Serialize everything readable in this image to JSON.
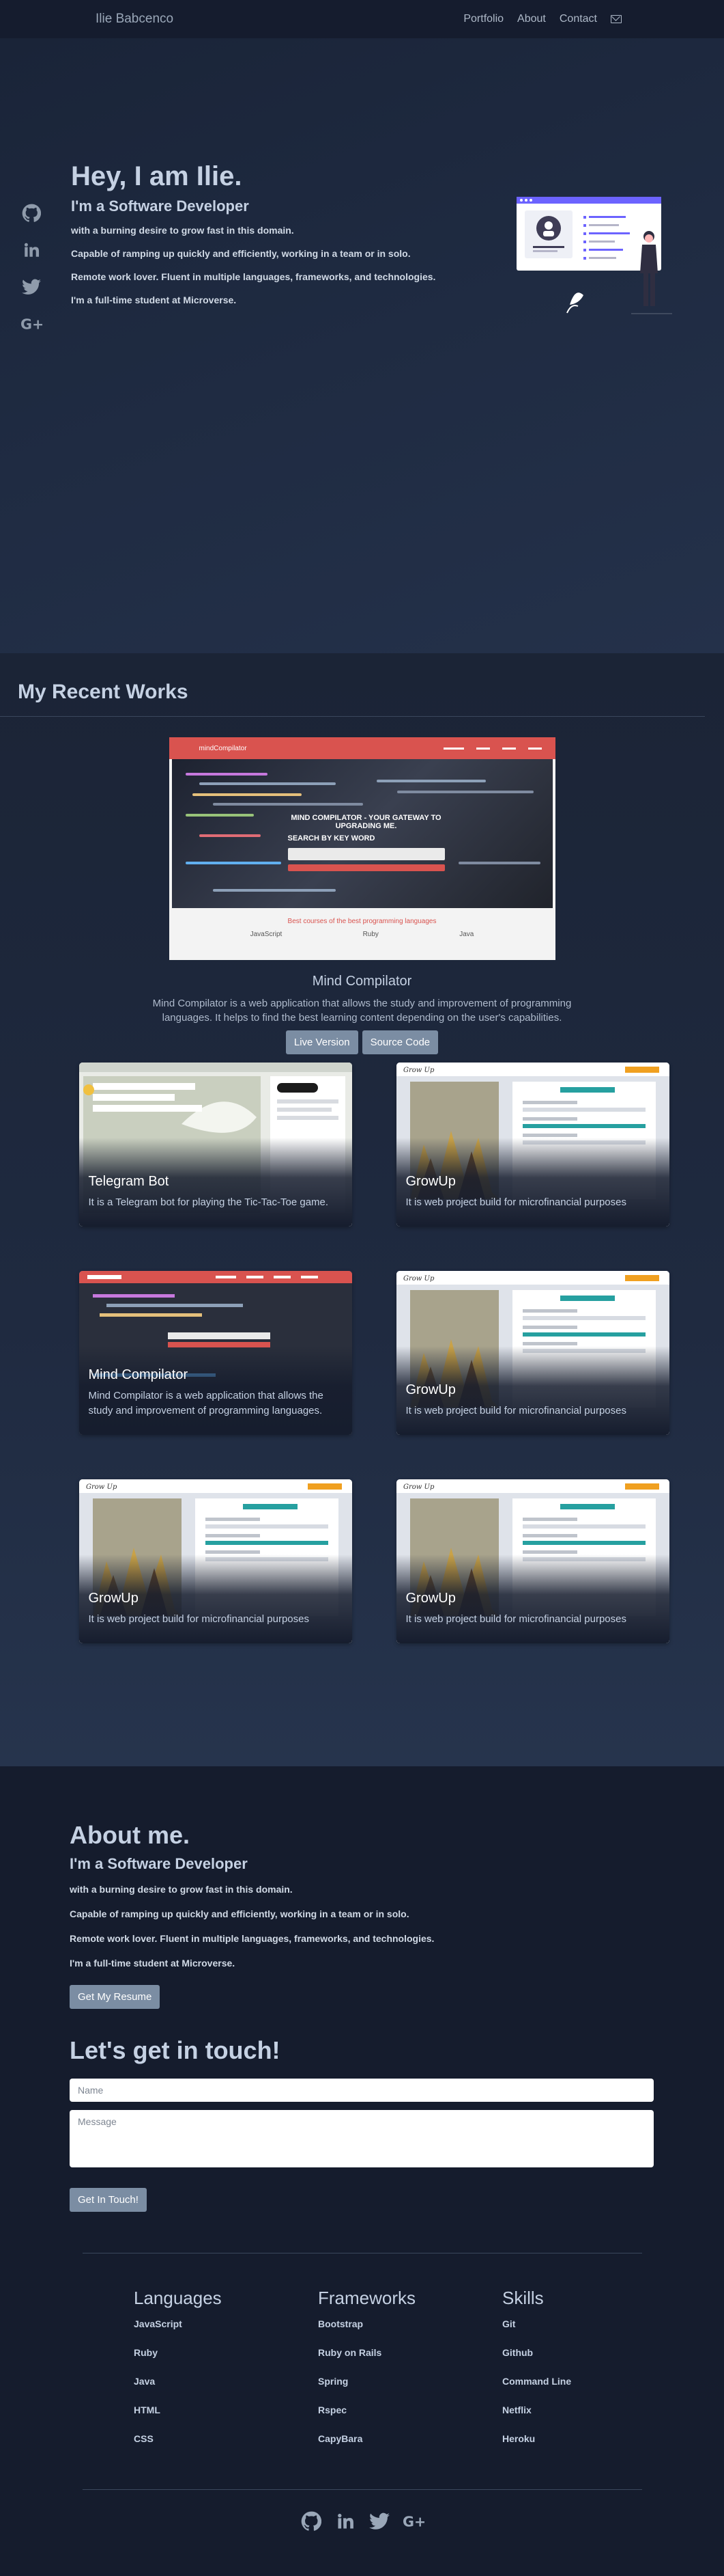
{
  "nav": {
    "brand": "Ilie Babcenco",
    "links": [
      "Portfolio",
      "About",
      "Contact"
    ]
  },
  "icons": {
    "github": "github-icon",
    "linkedin": "linkedin-icon",
    "twitter": "twitter-icon",
    "google": "google-plus-icon",
    "mail": "mail-icon"
  },
  "hero": {
    "title": "Hey, I am Ilie.",
    "subtitle": "I'm a Software Developer",
    "lines": [
      "with a burning desire to grow fast in this domain.",
      "Capable of ramping up quickly and efficiently, working in a team or in solo.",
      "Remote work lover. Fluent in multiple languages, frameworks, and technologies.",
      "I'm a full-time student at Microverse."
    ]
  },
  "works": {
    "title": "My Recent Works",
    "feature": {
      "shot_brand": "mindCompilator",
      "shot_heading": "MIND COMPILATOR - YOUR GATEWAY TO UPGRADING ME.",
      "shot_search": "SEARCH BY KEY WORD",
      "shot_caption": "Best courses of the best programming languages",
      "shot_langs": [
        "JavaScript",
        "Ruby",
        "Java"
      ],
      "title": "Mind Compilator",
      "description": "Mind Compilator is a web application that allows the study and improvement of programming languages. It helps to find the best learning content depending on the user's capabilities.",
      "live_label": "Live Version",
      "source_label": "Source Code"
    },
    "cards": [
      {
        "title": "Telegram Bot",
        "text": "It is a Telegram bot for playing the Tic-Tac-Toe game.",
        "kind": "telegram"
      },
      {
        "title": "GrowUp",
        "text": "It is web project build for microfinancial purposes",
        "kind": "growup"
      },
      {
        "title": "Mind Compilator",
        "text": "Mind Compilator is a web application that allows the study and improvement of programming languages.",
        "kind": "mind"
      },
      {
        "title": "GrowUp",
        "text": "It is web project build for microfinancial purposes",
        "kind": "growup"
      },
      {
        "title": "GrowUp",
        "text": "It is web project build for microfinancial purposes",
        "kind": "growup"
      },
      {
        "title": "GrowUp",
        "text": "It is web project build for microfinancial purposes",
        "kind": "growup"
      }
    ]
  },
  "about": {
    "title": "About me.",
    "subtitle": "I'm a Software Developer",
    "lines": [
      "with a burning desire to grow fast in this domain.",
      "Capable of ramping up quickly and efficiently, working in a team or in solo.",
      "Remote work lover. Fluent in multiple languages, frameworks, and technologies.",
      "I'm a full-time student at Microverse."
    ],
    "resume_label": "Get My Resume"
  },
  "contact": {
    "title": "Let's get in touch!",
    "name_placeholder": "Name",
    "message_placeholder": "Message",
    "submit_label": "Get In Touch!"
  },
  "footer": {
    "columns": [
      {
        "title": "Languages",
        "items": [
          "JavaScript",
          "Ruby",
          "Java",
          "HTML",
          "CSS"
        ]
      },
      {
        "title": "Frameworks",
        "items": [
          "Bootstrap",
          "Ruby on Rails",
          "Spring",
          "Rspec",
          "CapyBara"
        ]
      },
      {
        "title": "Skills",
        "items": [
          "Git",
          "Github",
          "Command Line",
          "Netflix",
          "Heroku"
        ]
      }
    ]
  },
  "colors": {
    "accent": "#7b8da3",
    "background": "#141b2d",
    "brand_red": "#d9534f"
  }
}
